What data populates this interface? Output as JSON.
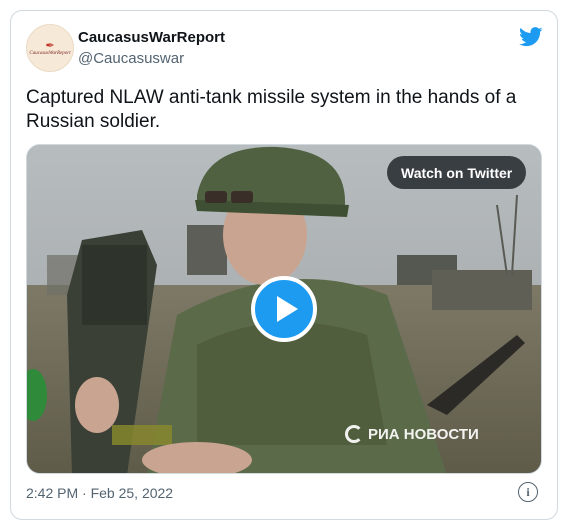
{
  "author": {
    "display_name": "CaucasusWarReport",
    "handle": "@Caucasuswar",
    "avatar_text": "CaucasusWarReport"
  },
  "tweet": {
    "text": "Captured NLAW anti-tank missile system in the hands of a Russian soldier."
  },
  "media": {
    "watch_label": "Watch on Twitter",
    "watermark": "РИА НОВОСТИ"
  },
  "footer": {
    "timestamp": "2:42 PM · Feb 25, 2022",
    "info_glyph": "i"
  },
  "icons": {
    "brand": "twitter-bird-icon",
    "play": "play-icon",
    "info": "info-icon"
  },
  "colors": {
    "accent": "#1d9bf0",
    "text_primary": "#0f1419",
    "text_secondary": "#536471",
    "border": "#cfd9de"
  }
}
